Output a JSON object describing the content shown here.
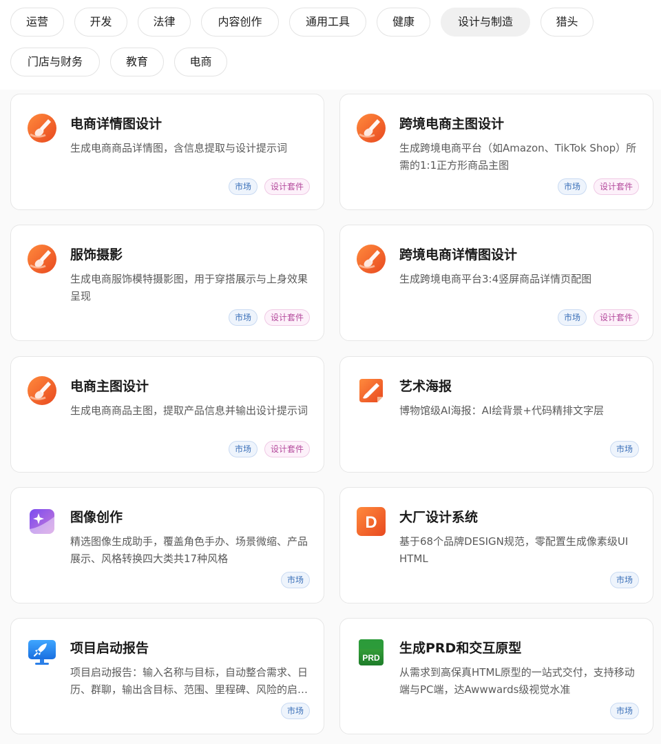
{
  "categories": [
    {
      "label": "运营",
      "active": false
    },
    {
      "label": "开发",
      "active": false
    },
    {
      "label": "法律",
      "active": false
    },
    {
      "label": "内容创作",
      "active": false
    },
    {
      "label": "通用工具",
      "active": false
    },
    {
      "label": "健康",
      "active": false
    },
    {
      "label": "设计与制造",
      "active": true
    },
    {
      "label": "猎头",
      "active": false
    },
    {
      "label": "门店与财务",
      "active": false
    },
    {
      "label": "教育",
      "active": false
    },
    {
      "label": "电商",
      "active": false
    }
  ],
  "cards": [
    {
      "title": "电商详情图设计",
      "desc": "生成电商商品详情图，含信息提取与设计提示词",
      "icon": "paint-brush-orange-icon",
      "tags": [
        "市场",
        "设计套件"
      ]
    },
    {
      "title": "跨境电商主图设计",
      "desc": "生成跨境电商平台（如Amazon、TikTok Shop）所需的1:1正方形商品主图",
      "icon": "paint-brush-orange-icon",
      "tags": [
        "市场",
        "设计套件"
      ]
    },
    {
      "title": "服饰摄影",
      "desc": "生成电商服饰模特摄影图，用于穿搭展示与上身效果呈现",
      "icon": "paint-brush-orange-icon",
      "tags": [
        "市场",
        "设计套件"
      ]
    },
    {
      "title": "跨境电商详情图设计",
      "desc": "生成跨境电商平台3:4竖屏商品详情页配图",
      "icon": "paint-brush-orange-icon",
      "tags": [
        "市场",
        "设计套件"
      ]
    },
    {
      "title": "电商主图设计",
      "desc": "生成电商商品主图，提取产品信息并输出设计提示词",
      "icon": "paint-brush-orange-icon",
      "tags": [
        "市场",
        "设计套件"
      ]
    },
    {
      "title": "艺术海报",
      "desc": "博物馆级AI海报：AI绘背景+代码精排文字层",
      "icon": "art-brush-icon",
      "tags": [
        "市场"
      ]
    },
    {
      "title": "图像创作",
      "desc": "精选图像生成助手，覆盖角色手办、场景微缩、产品展示、风格转换四大类共17种风格",
      "icon": "image-sparkle-icon",
      "tags": [
        "市场"
      ]
    },
    {
      "title": "大厂设计系统",
      "desc": "基于68个品牌DESIGN规范，零配置生成像素级UI HTML",
      "icon": "letter-d-icon",
      "tags": [
        "市场"
      ]
    },
    {
      "title": "项目启动报告",
      "desc": "项目启动报告：输入名称与目标，自动整合需求、日历、群聊，输出含目标、范围、里程碑、风险的启动报告",
      "icon": "rocket-monitor-icon",
      "tags": [
        "市场"
      ]
    },
    {
      "title": "生成PRD和交互原型",
      "desc": "从需求到高保真HTML原型的一站式交付，支持移动端与PC端，达Awwwards级视觉水准",
      "icon": "prd-icon",
      "tags": [
        "市场"
      ]
    }
  ],
  "icon_text": {
    "letter_d": "D",
    "prd": "PRD"
  },
  "tag_kinds": {
    "市场": "market",
    "设计套件": "kit"
  },
  "colors": {
    "market_tag": "#3a6fb8",
    "kit_tag": "#b44a9c",
    "active_chip": "#f0f0f0",
    "accent_orange": "#f26a2c"
  }
}
